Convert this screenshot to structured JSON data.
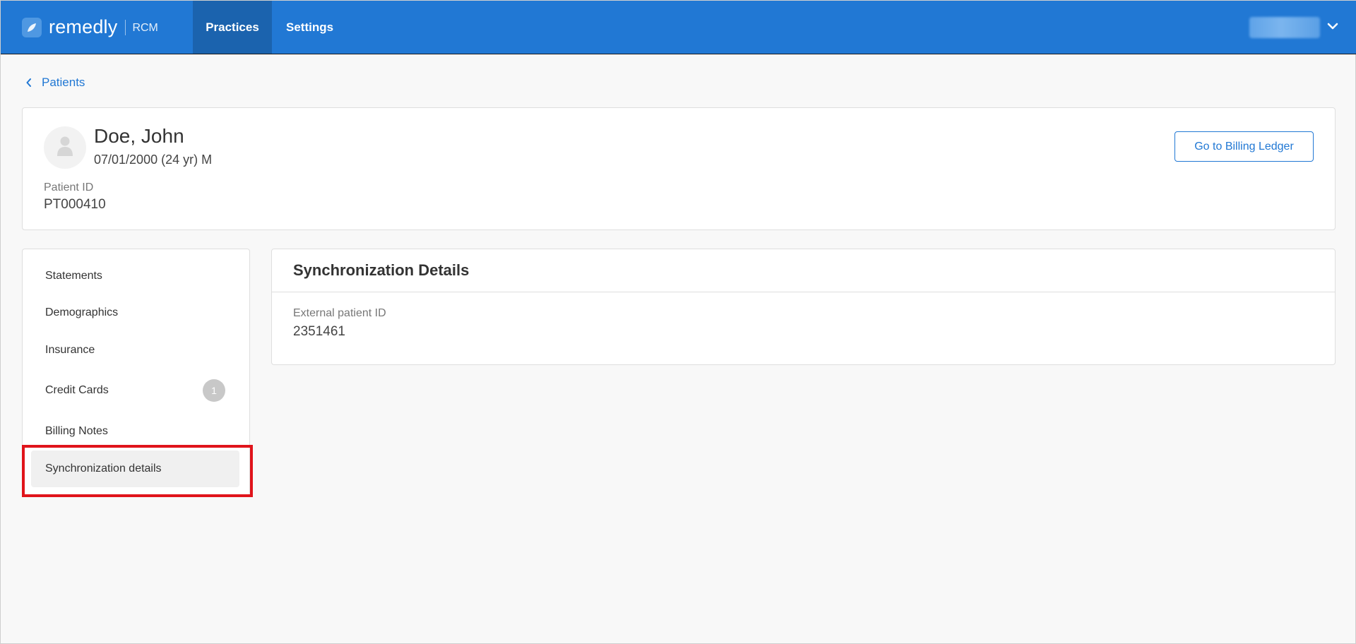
{
  "header": {
    "brand": "remedly",
    "brand_sub": "RCM",
    "tabs": [
      {
        "label": "Practices",
        "active": true
      },
      {
        "label": "Settings",
        "active": false
      }
    ],
    "user_menu_icon": "chevron-down-icon"
  },
  "breadcrumb": {
    "label": "Patients",
    "icon": "chevron-left-icon"
  },
  "patient": {
    "name": "Doe, John",
    "demographics": "07/01/2000 (24 yr) M",
    "id_label": "Patient ID",
    "id_value": "PT000410",
    "billing_ledger_button": "Go to Billing Ledger",
    "avatar_icon": "user-silhouette-icon"
  },
  "side_nav": {
    "items": [
      {
        "label": "Statements"
      },
      {
        "label": "Demographics"
      },
      {
        "label": "Insurance"
      },
      {
        "label": "Credit Cards",
        "badge": "1"
      },
      {
        "label": "Billing Notes"
      },
      {
        "label": "Synchronization details",
        "active": true
      }
    ]
  },
  "sync_panel": {
    "title": "Synchronization Details",
    "external_id_label": "External patient ID",
    "external_id_value": "2351461"
  },
  "colors": {
    "primary": "#2178d4",
    "active_tab": "#1b63ae",
    "highlight": "#e0141b"
  }
}
